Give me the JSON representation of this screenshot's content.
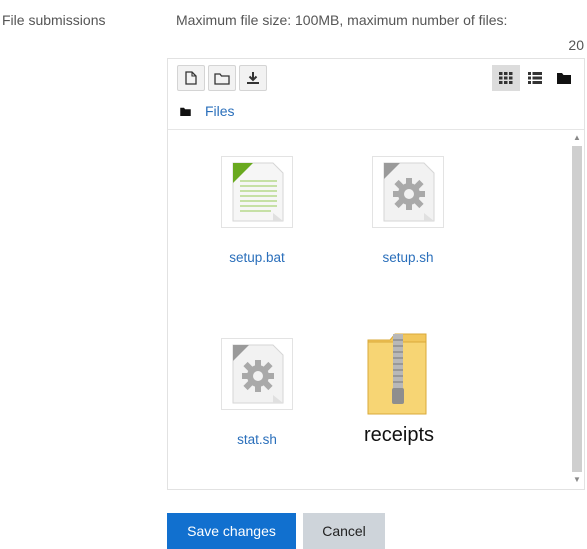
{
  "label": {
    "text": "File submissions"
  },
  "limits": {
    "text": "Maximum file size: 100MB, maximum number of files:",
    "count": "20"
  },
  "toolbar": {
    "buttons": [
      {
        "icon": "new-file-icon"
      },
      {
        "icon": "new-folder-icon"
      },
      {
        "icon": "download-icon"
      }
    ],
    "views": [
      {
        "icon": "grid-view-icon",
        "active": true
      },
      {
        "icon": "list-view-icon",
        "active": false
      },
      {
        "icon": "tree-view-icon",
        "active": false
      }
    ]
  },
  "path": {
    "crumb": "Files"
  },
  "files": [
    {
      "name": "setup.bat",
      "type": "text"
    },
    {
      "name": "setup.sh",
      "type": "script"
    },
    {
      "name": "stat.sh",
      "type": "script"
    },
    {
      "name": "receipts",
      "type": "zip"
    }
  ],
  "actions": {
    "save": "Save changes",
    "cancel": "Cancel"
  },
  "colors": {
    "primary": "#1170cf",
    "link": "#2a6fbb",
    "secondary": "#ced4da"
  }
}
